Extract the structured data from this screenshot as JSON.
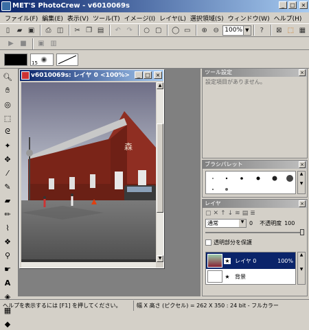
{
  "app": {
    "title": "MET'S PhotoCrew - v6010069s"
  },
  "menu": [
    "ファイル(F)",
    "編集(E)",
    "表示(V)",
    "ツール(T)",
    "イメージ(I)",
    "レイヤ(L)",
    "選択領域(S)",
    "ウィンドウ(W)",
    "ヘルプ(H)"
  ],
  "toolbar": {
    "zoom_value": "100%"
  },
  "brush": {
    "size": "15"
  },
  "document": {
    "title": "v6010069s: レイヤ 0 <100%>"
  },
  "tool_settings": {
    "title": "ツール設定",
    "message": "設定項目がありません。"
  },
  "brush_palette": {
    "title": "ブラシパレット"
  },
  "layers": {
    "title": "レイヤ",
    "blend_mode": "通常",
    "opacity_min": "0",
    "opacity_label": "不透明度",
    "opacity_value": "100",
    "preserve_label": "透明部分を保護",
    "items": [
      {
        "name": "レイヤ 0",
        "opacity": "100%"
      },
      {
        "name": "背景",
        "opacity": ""
      }
    ]
  },
  "status": {
    "help": "ヘルプを表示するには [F1] を押してください。",
    "info": "幅 X 高さ (ピクセル) = 262 X 350 : 24 bit - フルカラー"
  },
  "colors": {
    "title_start": "#0a246a",
    "title_end": "#a6caf0",
    "face": "#d4d0c8",
    "selected_layer": "#0a246a"
  }
}
